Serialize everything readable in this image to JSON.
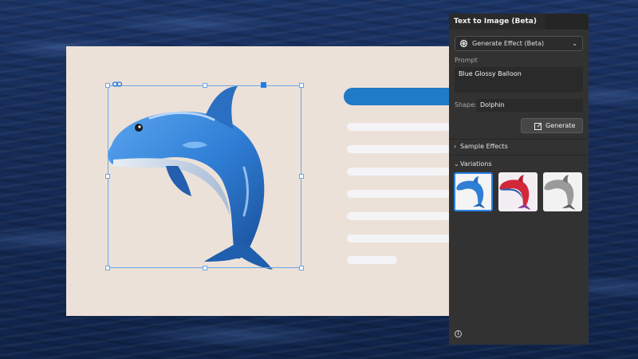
{
  "panel": {
    "tab_title": "Text to Image (Beta)",
    "effect_select": {
      "value": "Generate Effect (Beta)"
    },
    "prompt": {
      "label": "Prompt",
      "value": "Blue Glossy Balloon"
    },
    "shape": {
      "label": "Shape:",
      "value": "Dolphin"
    },
    "generate_button": {
      "label": "Generate"
    },
    "sections": {
      "sample_effects": "Sample Effects",
      "variations": "Variations"
    },
    "variations": [
      {
        "name": "blue",
        "selected": true,
        "color": "#2f7fd6"
      },
      {
        "name": "red",
        "selected": false,
        "color": "#d2283a"
      },
      {
        "name": "silver",
        "selected": false,
        "color": "#9a9a9a"
      }
    ]
  },
  "colors": {
    "accent": "#1f7de6",
    "panel_bg": "#323232",
    "artboard_bg": "#ece1d8",
    "placeholder_bar": "#1f7ac7",
    "dolphin": "#2f7fd6"
  }
}
